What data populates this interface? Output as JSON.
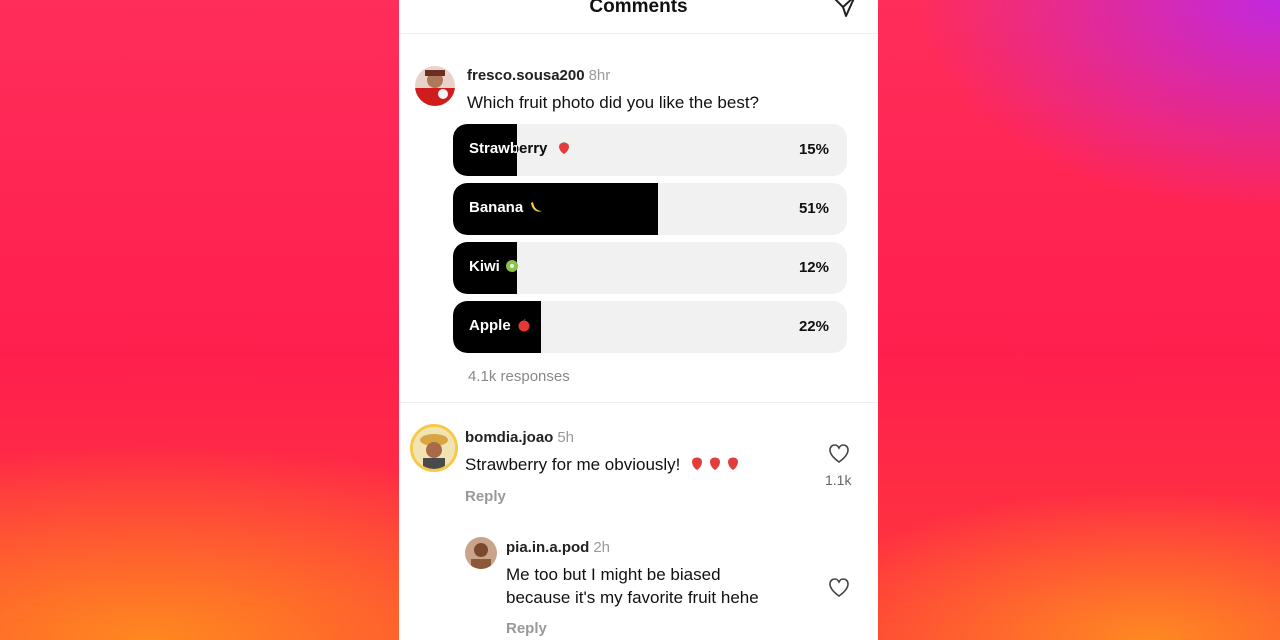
{
  "header": {
    "title": "Comments",
    "send_icon": "paper-plane-icon"
  },
  "poll_comment": {
    "username": "fresco.sousa200",
    "time": "8hr",
    "question": "Which fruit photo did you like the best?",
    "options": [
      {
        "label": "Strawberry",
        "emoji": "strawberry-icon",
        "percent_label": "15%",
        "fill_fraction": 0.15
      },
      {
        "label": "Banana",
        "emoji": "banana-icon",
        "percent_label": "51%",
        "fill_fraction": 0.51
      },
      {
        "label": "Kiwi",
        "emoji": "kiwi-icon",
        "percent_label": "12%",
        "fill_fraction": 0.12
      },
      {
        "label": "Apple",
        "emoji": "apple-icon",
        "percent_label": "22%",
        "fill_fraction": 0.22
      }
    ],
    "responses": "4.1k responses"
  },
  "comment": {
    "username": "bomdia.joao",
    "time": "5h",
    "text": "Strawberry for me obviously!",
    "emojis": "strawberry-icon x3",
    "reply_label": "Reply",
    "like_count": "1.1k"
  },
  "reply": {
    "username": "pia.in.a.pod",
    "time": "2h",
    "text_line1": "Me too but I might be biased",
    "text_line2": "because it's my favorite fruit hehe",
    "reply_label": "Reply"
  },
  "colors": {
    "poll_fill": "#000000",
    "poll_track": "#f1f1f1",
    "muted": "#999999"
  }
}
